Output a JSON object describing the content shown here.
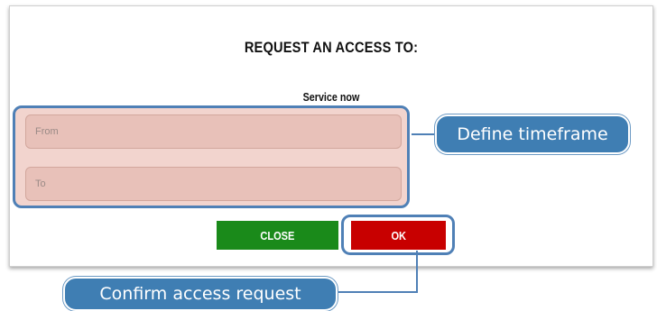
{
  "dialog": {
    "title": "REQUEST AN ACCESS TO:",
    "service_name": "Service now",
    "fields": {
      "from_placeholder": "From",
      "from_value": "",
      "to_placeholder": "To",
      "to_value": ""
    },
    "buttons": {
      "close_label": "CLOSE",
      "ok_label": "OK"
    }
  },
  "annotations": {
    "timeframe_label": "Define timeframe",
    "confirm_label": "Confirm access request"
  },
  "colors": {
    "close_button": "#1a8a1a",
    "ok_button": "#c80000",
    "callout": "#3f7eb3",
    "highlight_border": "#4f80b6",
    "field_fill": "#e8c1b9"
  }
}
